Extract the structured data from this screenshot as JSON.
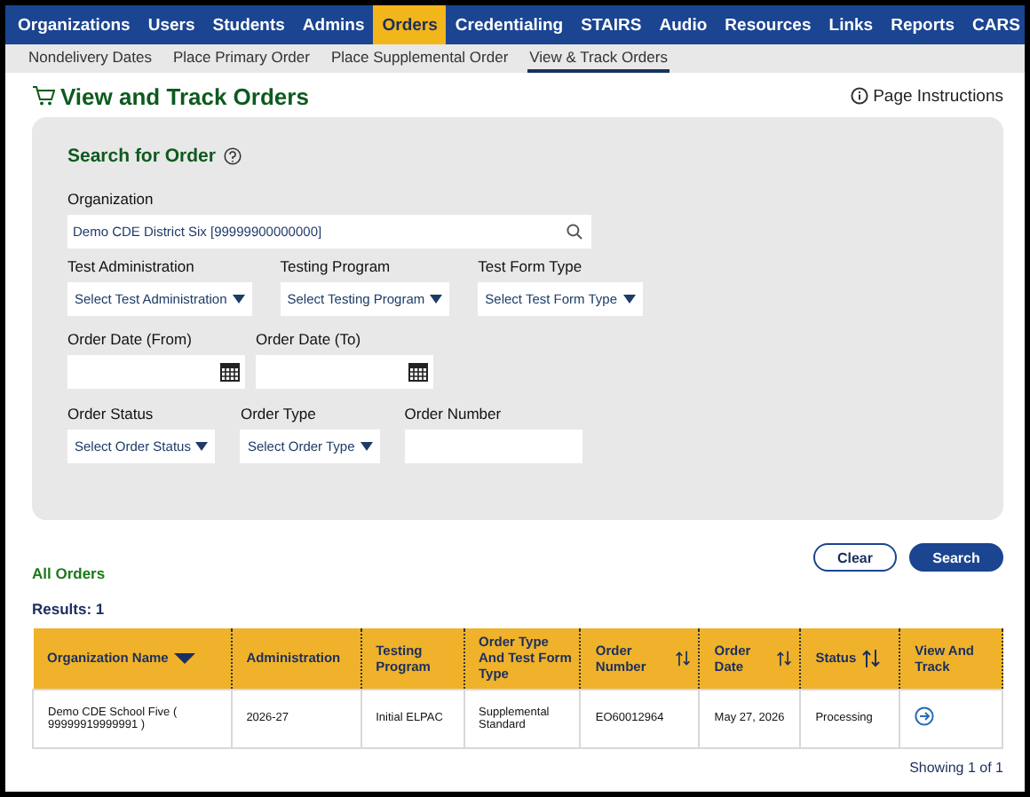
{
  "nav": [
    {
      "label": "Organizations",
      "selected": false
    },
    {
      "label": "Users",
      "selected": false
    },
    {
      "label": "Students",
      "selected": false
    },
    {
      "label": "Admins",
      "selected": false
    },
    {
      "label": "Orders",
      "selected": true
    },
    {
      "label": "Credentialing",
      "selected": false
    },
    {
      "label": "STAIRS",
      "selected": false
    },
    {
      "label": "Audio",
      "selected": false
    },
    {
      "label": "Resources",
      "selected": false
    },
    {
      "label": "Links",
      "selected": false
    },
    {
      "label": "Reports",
      "selected": false
    },
    {
      "label": "CARS",
      "selected": false
    }
  ],
  "subnav": [
    {
      "label": "Nondelivery Dates",
      "selected": false
    },
    {
      "label": "Place Primary Order",
      "selected": false
    },
    {
      "label": "Place Supplemental Order",
      "selected": false
    },
    {
      "label": "View & Track Orders",
      "selected": true
    }
  ],
  "page_title": "View and Track Orders",
  "page_instructions": "Page Instructions",
  "search": {
    "title": "Search for Order",
    "organization": {
      "label": "Organization",
      "value": "Demo CDE District Six [99999900000000]"
    },
    "row_1": [
      {
        "kind": "select",
        "label": "Test Administration",
        "value": "Select Test Administration"
      },
      {
        "kind": "select",
        "label": "Testing Program",
        "value": "Select Testing Program"
      },
      {
        "kind": "select",
        "label": "Test Form Type",
        "value": "Select Test Form Type"
      }
    ],
    "row_2": [
      {
        "kind": "date",
        "label": "Order Date (From)"
      },
      {
        "kind": "date",
        "label": "Order Date (To)"
      }
    ],
    "row_3": [
      {
        "kind": "select",
        "label": "Order Status",
        "value": "Select Order Status"
      },
      {
        "kind": "select",
        "label": "Order Type",
        "value": "Select Order Type"
      },
      {
        "kind": "text",
        "label": "Order Number"
      }
    ]
  },
  "buttons": [
    {
      "label": "Clear",
      "kind": "secondary"
    },
    {
      "label": "Search",
      "kind": "primary"
    }
  ],
  "section_title": "All Orders",
  "results": "Results: 1",
  "table": {
    "columns": [
      {
        "label": "Organization Name",
        "kind": "sorted"
      },
      {
        "label": "Administration",
        "kind": "plain"
      },
      {
        "label": "Testing Program",
        "kind": "plain"
      },
      {
        "label": "Order Type And Test Form Type",
        "kind": "plain"
      },
      {
        "label": "Order Number",
        "kind": "sortable"
      },
      {
        "label": "Order Date",
        "kind": "sortable"
      },
      {
        "label": "Status",
        "kind": "sortable"
      },
      {
        "label": "View And Track",
        "kind": "plain"
      }
    ],
    "rows": [
      {
        "cells": [
          "Demo CDE School Five ( 99999919999991 )",
          "2026-27",
          "Initial ELPAC",
          "Supplemental Standard",
          "EO60012964",
          "May 27, 2026",
          "Processing"
        ]
      }
    ]
  },
  "footer": "Showing 1 of 1"
}
